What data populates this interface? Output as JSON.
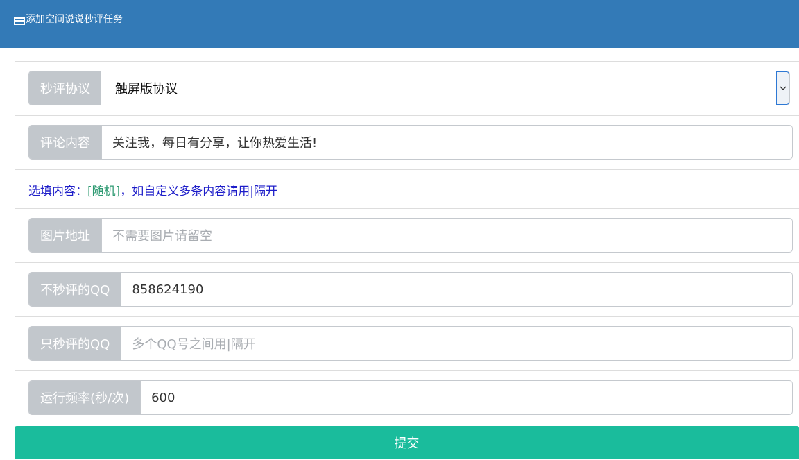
{
  "header": {
    "icon": "list-icon",
    "title": "添加空间说说秒评任务"
  },
  "form": {
    "protocol": {
      "label": "秒评协议",
      "selected": "触屏版协议"
    },
    "comment": {
      "label": "评论内容",
      "value": "关注我，每日有分享，让你热爱生活!"
    },
    "help": {
      "prefix": "选填内容：",
      "random_tag": "[随机]",
      "suffix": "，如自定义多条内容请用|隔开"
    },
    "image": {
      "label": "图片地址",
      "placeholder": "不需要图片请留空"
    },
    "exclude_qq": {
      "label": "不秒评的QQ",
      "value": "858624190"
    },
    "only_qq": {
      "label": "只秒评的QQ",
      "placeholder": "多个QQ号之间用|隔开"
    },
    "frequency": {
      "label": "运行频率(秒/次)",
      "value": "600"
    },
    "submit_label": "提交"
  },
  "colors": {
    "header": "#337ab7",
    "addon": "#c2c7cc",
    "submit": "#1abc9c",
    "help_text": "#1d1dc9",
    "help_highlight": "#2e9a72"
  }
}
